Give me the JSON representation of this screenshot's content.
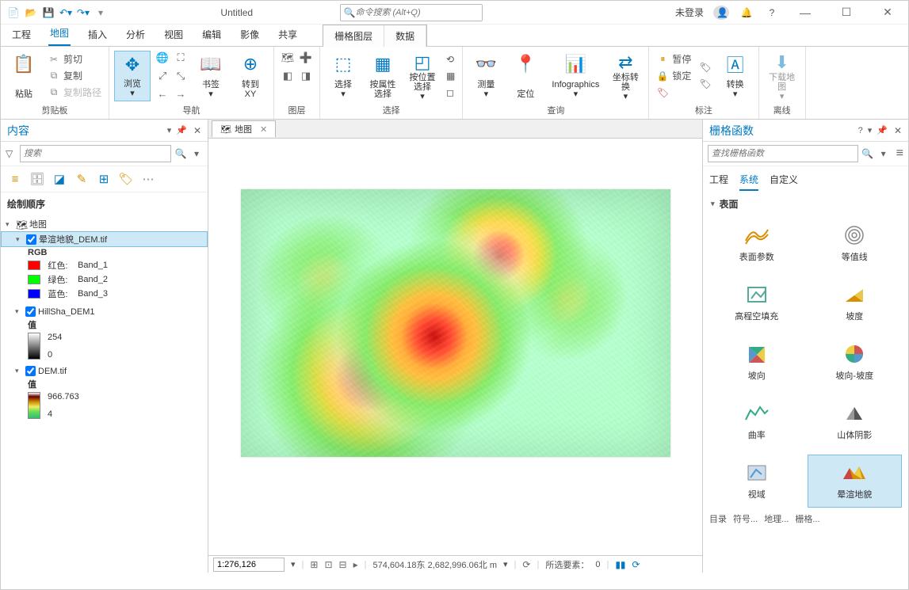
{
  "titlebar": {
    "title": "Untitled",
    "search_placeholder": "命令搜索 (Alt+Q)",
    "login": "未登录"
  },
  "ribbon_tabs": [
    "工程",
    "地图",
    "插入",
    "分析",
    "视图",
    "编辑",
    "影像",
    "共享"
  ],
  "ribbon_active": 1,
  "context_tabs": [
    "栅格图层",
    "数据"
  ],
  "ribbon": {
    "clipboard": {
      "label": "剪贴板",
      "paste": "粘贴",
      "cut": "剪切",
      "copy": "复制",
      "copypath": "复制路径"
    },
    "navigation": {
      "label": "导航",
      "browse": "浏览",
      "bookmark": "书签",
      "gotoxy": "转到\nXY"
    },
    "layers": {
      "label": "图层"
    },
    "selection": {
      "label": "选择",
      "select": "选择",
      "selattr": "按属性选择",
      "selloc": "按位置选择"
    },
    "query": {
      "label": "查询",
      "measure": "测量",
      "locate": "定位",
      "info": "Infographics",
      "coord": "坐标转换"
    },
    "annotate": {
      "label": "标注",
      "pause": "暂停",
      "lock": "锁定",
      "convert": "转换"
    },
    "offline": {
      "label": "离线",
      "download": "下载地图"
    }
  },
  "content_panel": {
    "title": "内容",
    "search_placeholder": "搜索",
    "draw_order": "绘制顺序",
    "map": "地图",
    "layers": [
      {
        "name": "晕渲地貌_DEM.tif",
        "checked": true,
        "selected": true
      },
      {
        "name": "HillSha_DEM1",
        "checked": true
      },
      {
        "name": "DEM.tif",
        "checked": true
      }
    ],
    "rgb_label": "RGB",
    "rgb": [
      {
        "color": "#ff0000",
        "label": "红色:",
        "band": "Band_1"
      },
      {
        "color": "#00ff00",
        "label": "绿色:",
        "band": "Band_2"
      },
      {
        "color": "#0000ff",
        "label": "蓝色:",
        "band": "Band_3"
      }
    ],
    "value_label": "值",
    "hillshade_range": {
      "max": "254",
      "min": "0"
    },
    "dem_range": {
      "max": "966.763",
      "min": "4"
    }
  },
  "map_tab": "地图",
  "raster_panel": {
    "title": "栅格函数",
    "search_placeholder": "查找栅格函数",
    "tabs": [
      "工程",
      "系统",
      "自定义"
    ],
    "active_tab": 1,
    "category": "表面",
    "functions": [
      "表面参数",
      "等值线",
      "高程空填充",
      "坡度",
      "坡向",
      "坡向-坡度",
      "曲率",
      "山体阴影",
      "视域",
      "晕渲地貌"
    ],
    "selected_function": 9
  },
  "statusbar": {
    "scale": "1:276,126",
    "coords": "574,604.18东 2,682,996.06北 m",
    "sel_label": "所选要素：",
    "sel_count": "0"
  },
  "bottom_tabs": [
    "目录",
    "符号...",
    "地理...",
    "栅格..."
  ]
}
